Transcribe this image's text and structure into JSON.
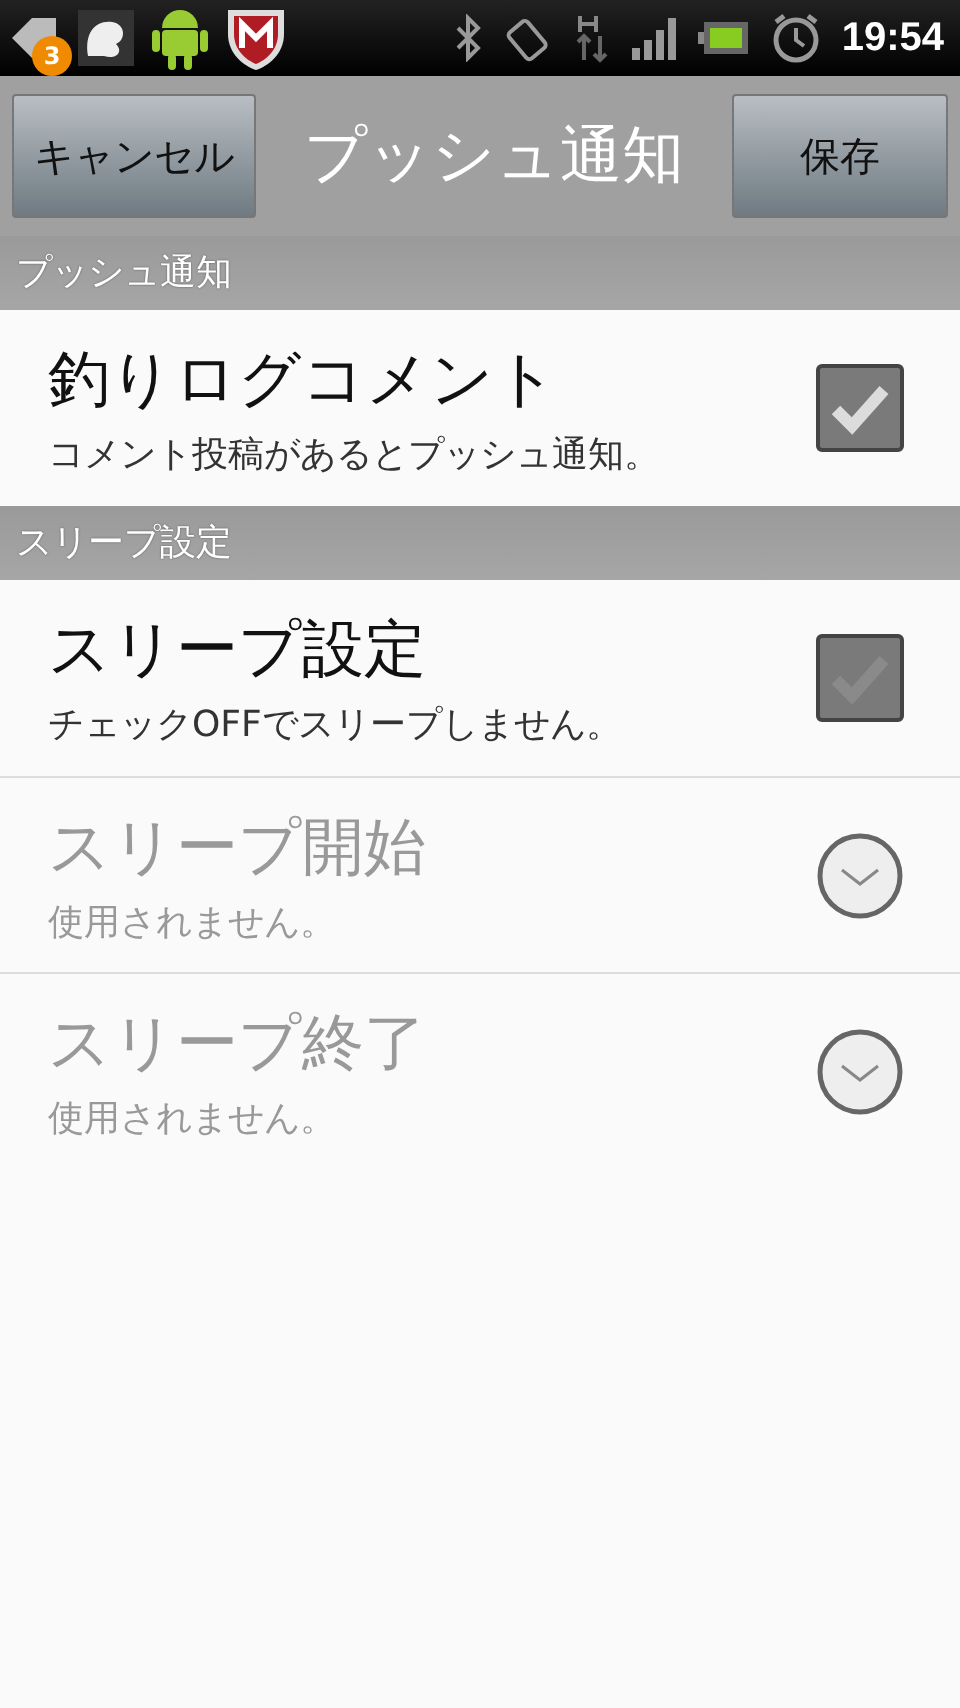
{
  "status_bar": {
    "notification_count": "3",
    "time": "19:54"
  },
  "action_bar": {
    "cancel": "キャンセル",
    "title": "プッシュ通知",
    "save": "保存"
  },
  "rows": [
    {
      "kind": "header",
      "label": "プッシュ通知"
    },
    {
      "kind": "checkbox",
      "title": "釣りログコメント",
      "summary": "コメント投稿があるとプッシュ通知。",
      "checked": true,
      "disabled": false
    },
    {
      "kind": "header",
      "label": "スリープ設定"
    },
    {
      "kind": "checkbox",
      "title": "スリープ設定",
      "summary": "チェックOFFでスリープしません。",
      "checked": false,
      "disabled": false
    },
    {
      "kind": "time",
      "title": "スリープ開始",
      "summary": "使用されません。",
      "disabled": true
    },
    {
      "kind": "time",
      "title": "スリープ終了",
      "summary": "使用されません。",
      "disabled": true
    }
  ]
}
